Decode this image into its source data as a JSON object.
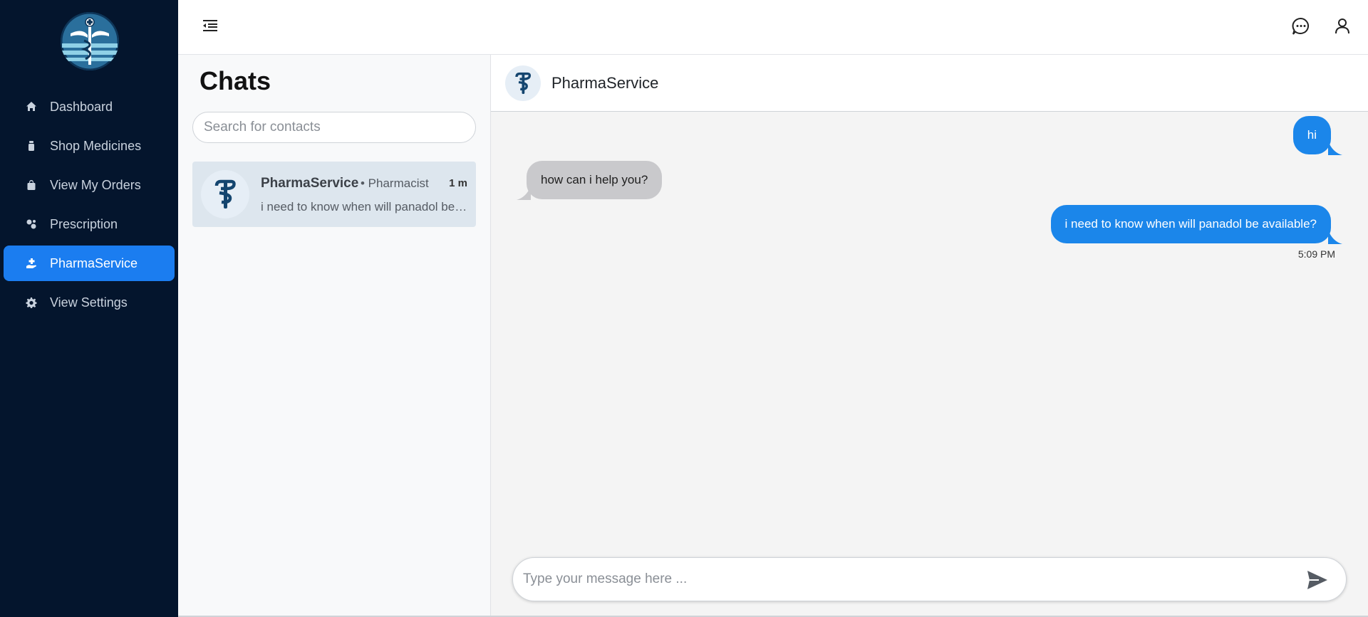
{
  "colors": {
    "sidebar_bg": "#04152d",
    "accent": "#1b7df0",
    "outgoing_bubble": "#1b86ea",
    "incoming_bubble": "#c9c9cc"
  },
  "sidebar": {
    "logo_icon": "caduceus-logo",
    "items": [
      {
        "label": "Dashboard",
        "icon": "home-icon",
        "active": false
      },
      {
        "label": "Shop Medicines",
        "icon": "medicine-bottle-icon",
        "active": false
      },
      {
        "label": "View My Orders",
        "icon": "shopping-bag-icon",
        "active": false
      },
      {
        "label": "Prescription",
        "icon": "pills-icon",
        "active": false
      },
      {
        "label": "PharmaService",
        "icon": "hand-holding-medical-icon",
        "active": true
      },
      {
        "label": "View Settings",
        "icon": "gear-icon",
        "active": false
      }
    ]
  },
  "topbar": {
    "menu_icon": "menu-indent-icon",
    "chat_icon": "chat-bubble-icon",
    "user_icon": "user-icon"
  },
  "chats": {
    "title": "Chats",
    "search_placeholder": "Search for contacts",
    "contacts": [
      {
        "name": "PharmaService",
        "role": "• Pharmacist",
        "time": "1 m",
        "preview": "i need to know when will panadol be available?"
      }
    ]
  },
  "conversation": {
    "contact_name": "PharmaService",
    "messages": [
      {
        "text": "hi",
        "direction": "outgoing"
      },
      {
        "text": "how can i help you?",
        "direction": "incoming"
      },
      {
        "text": "i need to know when will panadol be available?",
        "direction": "outgoing",
        "time": "5:09 PM"
      }
    ],
    "input_placeholder": "Type your message here ...",
    "send_icon": "send-icon"
  }
}
